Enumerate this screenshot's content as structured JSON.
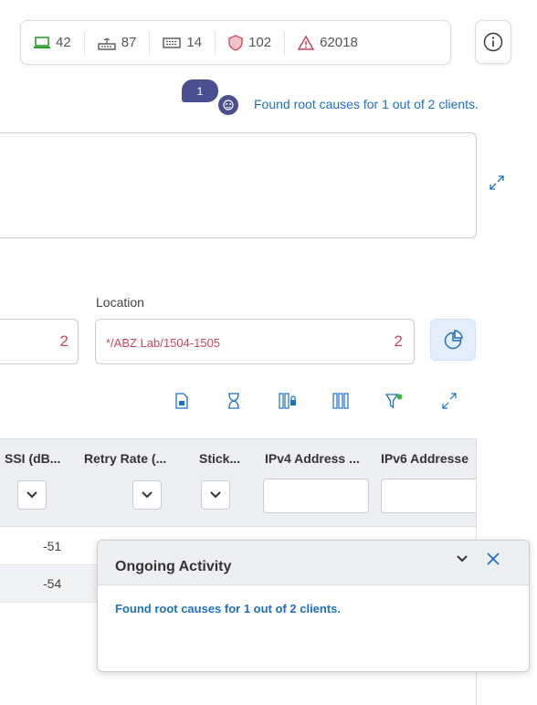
{
  "stats": [
    {
      "icon": "laptop-icon",
      "value": "42",
      "color": "#2aa02a"
    },
    {
      "icon": "access-point-icon",
      "value": "87",
      "color": "#555555"
    },
    {
      "icon": "switch-icon",
      "value": "14",
      "color": "#555555"
    },
    {
      "icon": "shield-icon",
      "value": "102",
      "color": "#d0465a"
    },
    {
      "icon": "warning-icon",
      "value": "62018",
      "color": "#d0465a"
    }
  ],
  "notification": {
    "count": "1",
    "text": "Found root causes for 1 out of 2 clients."
  },
  "filters": {
    "left_count": "2",
    "location_label": "Location",
    "location_value": "*/ABZ Lab/1504-1505",
    "location_count": "2"
  },
  "table": {
    "columns": [
      "SSI (dB...",
      "Retry Rate (...",
      "Stick...",
      "IPv4 Address ...",
      "IPv6 Addresse"
    ],
    "rows": [
      {
        "rssi": "-51"
      },
      {
        "rssi": "-54"
      }
    ]
  },
  "activity": {
    "title": "Ongoing Activity",
    "message": "Found root causes for 1 out of 2 clients."
  },
  "colors": {
    "accent": "#1f6fc4",
    "alert": "#d0465a",
    "bubble": "#4a4f8f"
  }
}
